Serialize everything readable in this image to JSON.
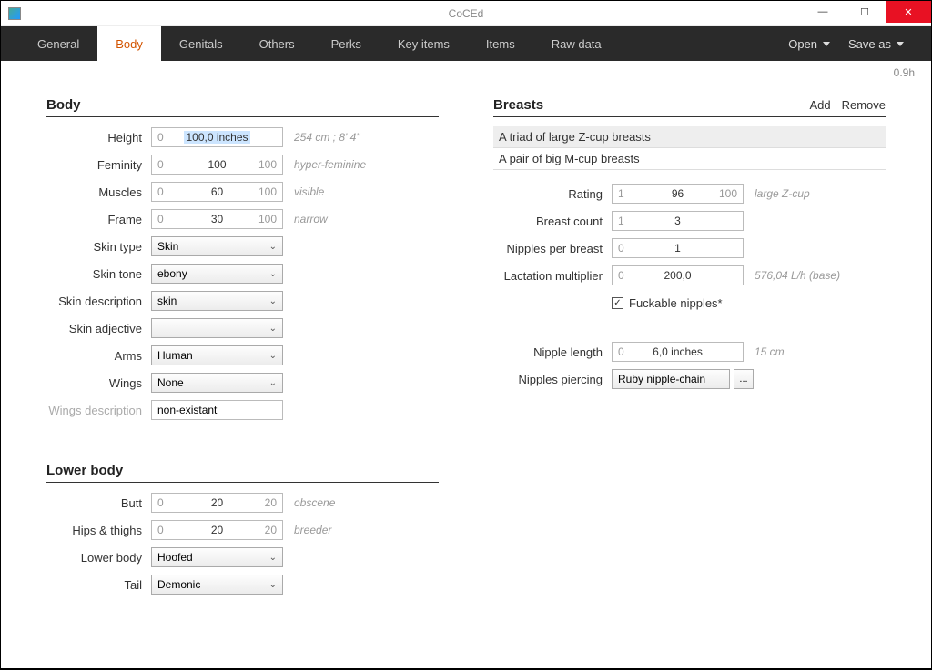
{
  "window": {
    "title": "CoCEd",
    "min": "—",
    "max": "☐",
    "close": "✕"
  },
  "tabs": [
    "General",
    "Body",
    "Genitals",
    "Others",
    "Perks",
    "Key items",
    "Items",
    "Raw data"
  ],
  "active_tab": "Body",
  "menu": {
    "open": "Open",
    "save": "Save as"
  },
  "version": "0.9h",
  "body": {
    "title": "Body",
    "height": {
      "label": "Height",
      "min": "0",
      "val": "100,0 inches",
      "hint": "254 cm ; 8' 4\""
    },
    "feminity": {
      "label": "Feminity",
      "min": "0",
      "val": "100",
      "max": "100",
      "hint": "hyper-feminine"
    },
    "muscles": {
      "label": "Muscles",
      "min": "0",
      "val": "60",
      "max": "100",
      "hint": "visible"
    },
    "frame": {
      "label": "Frame",
      "min": "0",
      "val": "30",
      "max": "100",
      "hint": "narrow"
    },
    "skin_type": {
      "label": "Skin type",
      "val": "Skin"
    },
    "skin_tone": {
      "label": "Skin tone",
      "val": "ebony"
    },
    "skin_desc": {
      "label": "Skin description",
      "val": "skin"
    },
    "skin_adj": {
      "label": "Skin adjective",
      "val": ""
    },
    "arms": {
      "label": "Arms",
      "val": "Human"
    },
    "wings": {
      "label": "Wings",
      "val": "None"
    },
    "wings_desc": {
      "label": "Wings description",
      "val": "non-existant"
    }
  },
  "lower": {
    "title": "Lower body",
    "butt": {
      "label": "Butt",
      "min": "0",
      "val": "20",
      "max": "20",
      "hint": "obscene"
    },
    "hips": {
      "label": "Hips & thighs",
      "min": "0",
      "val": "20",
      "max": "20",
      "hint": "breeder"
    },
    "lower_body": {
      "label": "Lower body",
      "val": "Hoofed"
    },
    "tail": {
      "label": "Tail",
      "val": "Demonic"
    }
  },
  "breasts": {
    "title": "Breasts",
    "add": "Add",
    "remove": "Remove",
    "list": [
      "A triad of large Z-cup breasts",
      "A pair of big M-cup breasts"
    ],
    "rating": {
      "label": "Rating",
      "min": "1",
      "val": "96",
      "max": "100",
      "hint": "large Z-cup"
    },
    "count": {
      "label": "Breast count",
      "min": "1",
      "val": "3"
    },
    "npb": {
      "label": "Nipples per breast",
      "min": "0",
      "val": "1"
    },
    "lact": {
      "label": "Lactation multiplier",
      "min": "0",
      "val": "200,0",
      "hint": "576,04 L/h (base)"
    },
    "fuckable": {
      "label": "Fuckable nipples*",
      "checked": true
    },
    "nip_len": {
      "label": "Nipple length",
      "min": "0",
      "val": "6,0 inches",
      "hint": "15 cm"
    },
    "piercing": {
      "label": "Nipples piercing",
      "val": "Ruby nipple-chain",
      "btn": "..."
    }
  }
}
